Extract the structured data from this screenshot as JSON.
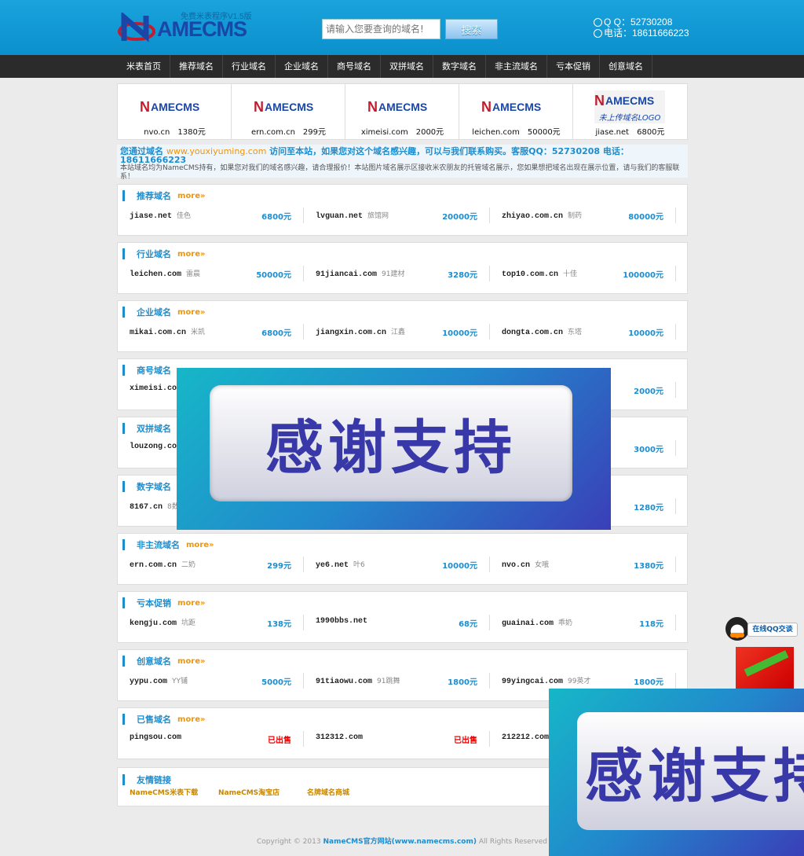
{
  "header": {
    "logo_text": "AMECMS",
    "logo_tagline": "免费米表程序V1.5版",
    "search_placeholder": "请输入您要查询的域名!",
    "search_button": "搜索",
    "qq_line": "Q Q：52730208",
    "phone_line": "电话：18611666223"
  },
  "nav": [
    "米表首页",
    "推荐域名",
    "行业域名",
    "企业域名",
    "商号域名",
    "双拼域名",
    "数字域名",
    "非主流域名",
    "亏本促销",
    "创意域名"
  ],
  "showcase": {
    "logo_text": "AMECMS",
    "last_logo_tagline": "未上传域名LOGO",
    "items": [
      {
        "caption": "nvo.cn　1380元"
      },
      {
        "caption": "ern.com.cn　299元"
      },
      {
        "caption": "ximeisi.com　2000元"
      },
      {
        "caption": "leichen.com　50000元"
      },
      {
        "caption": "jiase.net　6800元"
      }
    ]
  },
  "notice": {
    "line1_pre": "您通过域名",
    "line1_domain": "www.youxiyuming.com",
    "line1_post": "访问至本站，如果您对这个域名感兴趣，可以与我们联系购买。客服QQ：52730208 电话：18611666223",
    "line2": "本站域名均为NameCMS持有，如果您对我们的域名感兴趣，请合理报价！本站图片域名展示区接收米农朋友的托管域名展示，您如果想把域名出现在展示位置，请与我们的客服联系！"
  },
  "more_label": "more»",
  "sections": [
    {
      "title": "推荐域名",
      "rows": [
        [
          "jiase.net",
          "佳色",
          "6800元"
        ],
        [
          "lvguan.net",
          "旅馆网",
          "20000元"
        ],
        [
          "zhiyao.com.cn",
          "制药",
          "80000元"
        ]
      ]
    },
    {
      "title": "行业域名",
      "rows": [
        [
          "leichen.com",
          "雷晨",
          "50000元"
        ],
        [
          "91jiancai.com",
          "91建材",
          "3280元"
        ],
        [
          "top10.com.cn",
          "十佳",
          "100000元"
        ]
      ]
    },
    {
      "title": "企业域名",
      "rows": [
        [
          "mikai.com.cn",
          "米凯",
          "6800元"
        ],
        [
          "jiangxin.com.cn",
          "江鑫",
          "10000元"
        ],
        [
          "dongta.com.cn",
          "东塔",
          "10000元"
        ]
      ]
    },
    {
      "title": "商号域名",
      "rows": [
        [
          "ximeisi.com",
          "",
          ""
        ],
        [
          "",
          "",
          ""
        ],
        [
          "",
          "",
          "2000元"
        ]
      ]
    },
    {
      "title": "双拼域名",
      "rows": [
        [
          "louzong.com",
          "",
          ""
        ],
        [
          "",
          "",
          ""
        ],
        [
          "",
          "",
          "3000元"
        ]
      ]
    },
    {
      "title": "数字域名",
      "rows": [
        [
          "8167.cn",
          "8数字",
          ""
        ],
        [
          "",
          "",
          ""
        ],
        [
          "",
          "",
          "1280元"
        ]
      ]
    },
    {
      "title": "非主流域名",
      "rows": [
        [
          "ern.com.cn",
          "二奶",
          "299元"
        ],
        [
          "ye6.net",
          "叶6",
          "10000元"
        ],
        [
          "nvo.cn",
          "女哦",
          "1380元"
        ]
      ]
    },
    {
      "title": "亏本促销",
      "rows": [
        [
          "kengju.com",
          "坑距",
          "138元"
        ],
        [
          "1990bbs.net",
          "",
          "68元"
        ],
        [
          "guainai.com",
          "乖奶",
          "118元"
        ]
      ]
    },
    {
      "title": "创意域名",
      "rows": [
        [
          "yypu.com",
          "YY铺",
          "5000元"
        ],
        [
          "91tiaowu.com",
          "91跳舞",
          "1800元"
        ],
        [
          "99yingcai.com",
          "99英才",
          "1800元"
        ]
      ]
    },
    {
      "title": "已售域名",
      "rows": [
        [
          "pingsou.com",
          "",
          "已出售"
        ],
        [
          "312312.com",
          "",
          "已出售"
        ],
        [
          "212212.com",
          "",
          ""
        ]
      ]
    }
  ],
  "friend_links": {
    "title": "友情链接",
    "items": [
      "NameCMS米表下载",
      "NameCMS淘宝店",
      "名牌域名商城"
    ]
  },
  "footer": {
    "pre": "Copyright © 2013",
    "site": "NameCMS官方网站(www.namecms.com)",
    "post": "All Rights Reserved"
  },
  "overlay_text": "感谢支持",
  "overlay_text_cropped": "感谢支持",
  "qq_widget_label": "在线QQ交谈",
  "colors": {
    "header_blue": "#0b90cc",
    "nav_dark": "#2b2b2b",
    "accent_blue": "#1e8dcd",
    "accent_orange": "#f29500",
    "sold_red": "#ee0000"
  }
}
